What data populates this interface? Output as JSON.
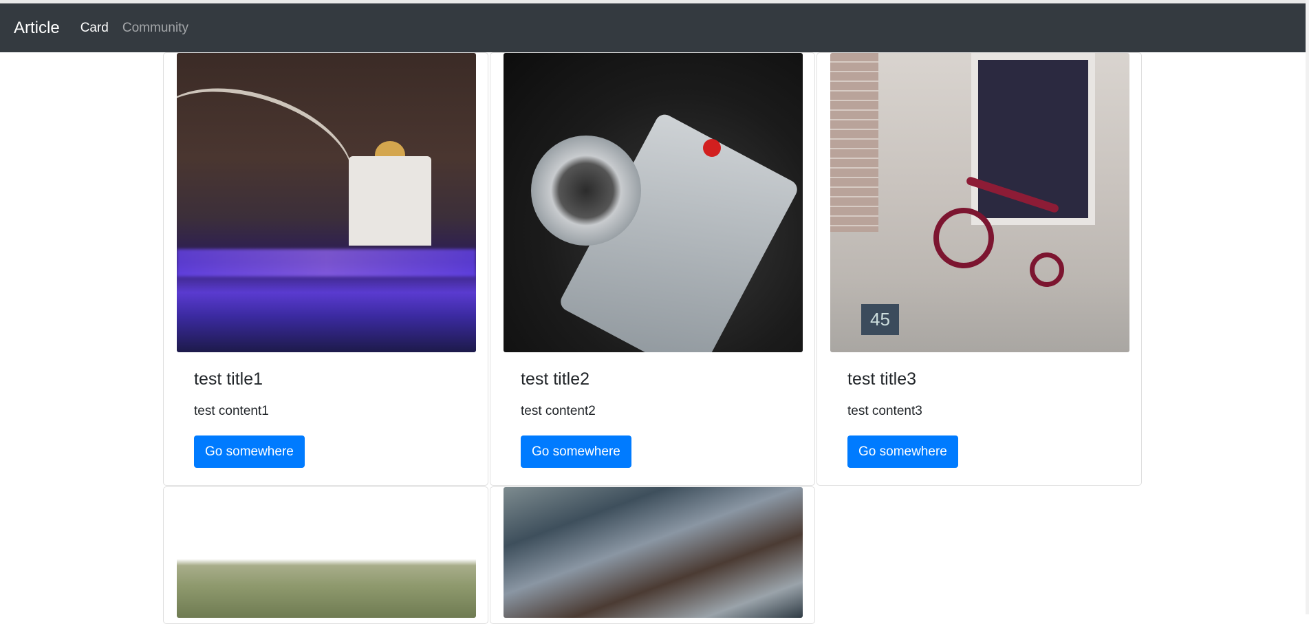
{
  "navbar": {
    "brand": "Article",
    "links": [
      {
        "label": "Card",
        "active": true
      },
      {
        "label": "Community",
        "active": false
      }
    ]
  },
  "cards": [
    {
      "title": "test title1",
      "content": "test content1",
      "button": "Go somewhere",
      "image": "night-bridge-cathedral-photo"
    },
    {
      "title": "test title2",
      "content": "test content2",
      "button": "Go somewhere",
      "image": "vintage-camera-photo"
    },
    {
      "title": "test title3",
      "content": "test content3",
      "button": "Go somewhere",
      "image": "red-tricycle-photo"
    },
    {
      "image": "grass-field-photo"
    },
    {
      "image": "water-texture-photo"
    }
  ],
  "image_labels": {
    "plate_number": "45"
  },
  "colors": {
    "navbar_bg": "#343a40",
    "primary_button": "#007bff"
  }
}
